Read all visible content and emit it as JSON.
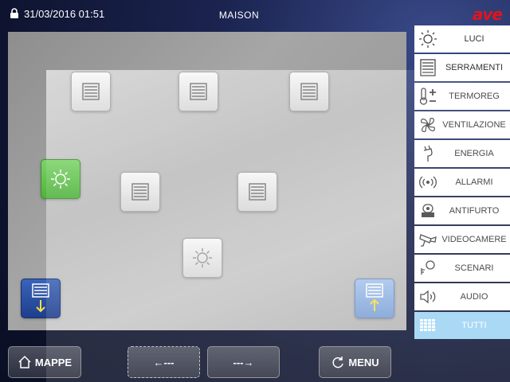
{
  "header": {
    "datetime": "31/03/2016 01:51",
    "title": "MAISON",
    "logo": "ave"
  },
  "menu": [
    {
      "label": "LUCI",
      "icon": "sun-icon"
    },
    {
      "label": "SERRAMENTI",
      "icon": "shutter-icon"
    },
    {
      "label": "TERMOREG",
      "icon": "thermometer-icon"
    },
    {
      "label": "VENTILAZIONE",
      "icon": "fan-icon"
    },
    {
      "label": "ENERGIA",
      "icon": "plug-icon"
    },
    {
      "label": "ALLARMI",
      "icon": "alarm-waves-icon"
    },
    {
      "label": "ANTIFURTO",
      "icon": "siren-icon"
    },
    {
      "label": "VIDEOCAMERE",
      "icon": "camera-icon"
    },
    {
      "label": "SCENARI",
      "icon": "scenario-icon"
    },
    {
      "label": "AUDIO",
      "icon": "speaker-icon"
    },
    {
      "label": "TUTTI",
      "icon": "grid-icon",
      "active": true
    }
  ],
  "bottom": {
    "mappe_label": "MAPPE",
    "prev_label": "←---",
    "next_label": "---→",
    "menu_label": "MENU"
  },
  "colors": {
    "accent": "#9fd4f4",
    "light_on": "#4fb23c",
    "logo_red": "#e3141b"
  }
}
